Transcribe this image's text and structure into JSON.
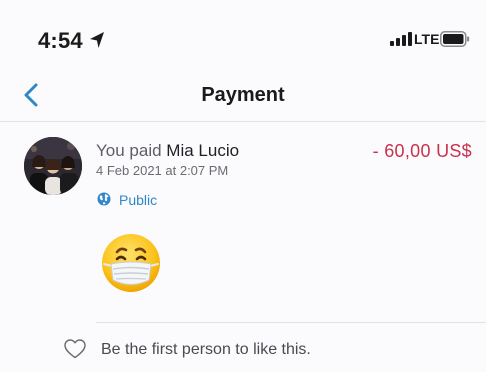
{
  "status_bar": {
    "time": "4:54",
    "carrier": "LTE",
    "icons": [
      "location-arrow-icon",
      "signal-icon",
      "battery-icon"
    ]
  },
  "nav": {
    "back_icon": "chevron-left-icon",
    "title": "Payment"
  },
  "transaction": {
    "prefix": "You paid",
    "payee": "Mia Lucio",
    "amount": "- 60,00 US$",
    "timestamp": "4 Feb 2021 at 2:07 PM",
    "visibility_icon": "globe-icon",
    "visibility": "Public",
    "note_emoji": "face-with-medical-mask"
  },
  "likes": {
    "icon": "heart-icon",
    "text": "Be the first person to like this."
  },
  "colors": {
    "accent_blue": "#2f86c8",
    "amount_red": "#c8324c",
    "divider": "#e3e3e6"
  }
}
